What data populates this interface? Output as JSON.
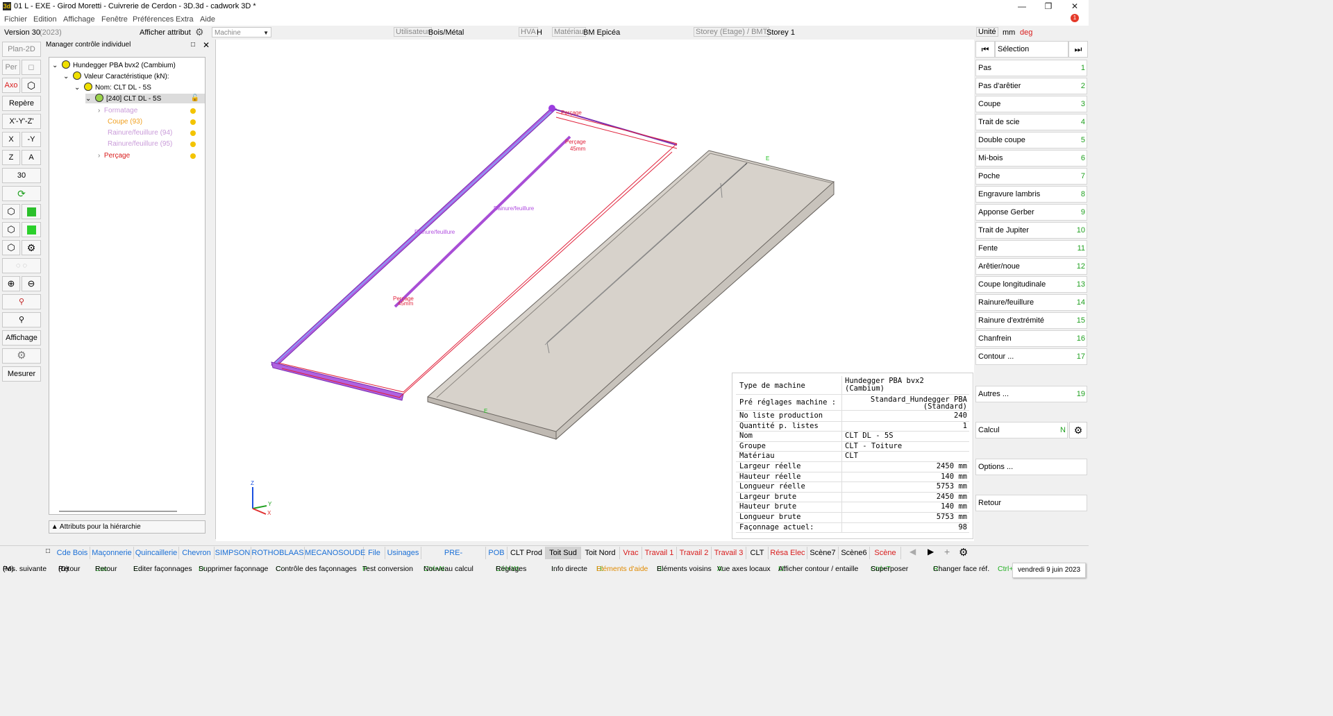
{
  "window": {
    "title": "01 L - EXE - Girod Moretti - Cuivrerie de Cerdon - 3D.3d - cadwork 3D *",
    "app_icon": "3d",
    "notification_count": "1"
  },
  "menu": [
    "Fichier",
    "Edition",
    "Affichage",
    "Fenêtre",
    "Préférences",
    "Extra",
    "Aide"
  ],
  "attrbar": {
    "version": "Version 30",
    "version_year": "(2023)",
    "afficher_attribut": "Afficher attribut",
    "machine_placeholder": "Machine",
    "utilisateur_label": "Utilisateur",
    "utilisateur_value": "Bois/Métal",
    "hva_label": "HVA",
    "hva_value": "H",
    "materiau_label": "Matériau",
    "materiau_value": "BM Epicéa",
    "storey_label": "Storey (Etage) / BMT",
    "storey_value": "Storey 1",
    "unite_label": "Unité",
    "unite_mm": "mm",
    "unite_deg": "deg"
  },
  "lefttb": {
    "plan2d": "Plan-2D",
    "per": "Per",
    "axo": "Axo",
    "repere": "Repère",
    "xyz": "X'-Y'-Z'",
    "x": "X",
    "mx": "-Y",
    "z": "Z",
    "a": "A",
    "thirty": "30",
    "affichage": "Affichage",
    "mesurer": "Mesurer"
  },
  "tree": {
    "panel_title": "Manager contrôle individuel",
    "items": [
      {
        "label": "Hundegger PBA bvx2 (Cambium)"
      },
      {
        "label": "Valeur Caractéristique (kN):"
      },
      {
        "label": "Nom: CLT DL - 5S"
      },
      {
        "label": "[240] CLT DL - 5S"
      },
      {
        "label": "Formatage"
      },
      {
        "label": "Coupe (93)"
      },
      {
        "label": "Rainure/feuillure (94)"
      },
      {
        "label": "Rainure/feuillure (95)"
      },
      {
        "label": "Perçage"
      }
    ],
    "hierarchy_button": "Attributs pour la hiérarchie"
  },
  "viewport": {
    "labels": {
      "percage1": "Perçage",
      "percage1_mm": "45mm",
      "percage2": "Perçage",
      "percage2_mm": "45mm",
      "rainure1": "Rainure/feuillure",
      "rainure2": "Rainure/feuillure",
      "percage_top": "Perçage",
      "axis_z": "Z",
      "axis_y": "Y",
      "axis_x": "X",
      "e1": "E",
      "e2": "E"
    }
  },
  "infotable": {
    "rows": [
      {
        "k": "Type de machine",
        "v": "Hundegger PBA bvx2",
        "v2": "(Cambium)"
      },
      {
        "k": "Pré réglages machine :",
        "v": "Standard_Hundegger PBA",
        "v2": "(Standard)"
      },
      {
        "k": "No liste production",
        "v": "240"
      },
      {
        "k": "Quantité p. listes",
        "v": "1"
      },
      {
        "k": "Nom",
        "v": "CLT DL - 5S"
      },
      {
        "k": "Groupe",
        "v": "CLT - Toiture"
      },
      {
        "k": "Matériau",
        "v": "CLT"
      },
      {
        "k": "Largeur réelle",
        "v": "2450  mm"
      },
      {
        "k": "Hauteur réelle",
        "v": "140  mm"
      },
      {
        "k": "Longueur réelle",
        "v": "5753  mm"
      },
      {
        "k": "Largeur brute",
        "v": "2450  mm"
      },
      {
        "k": "Hauteur brute",
        "v": "140  mm"
      },
      {
        "k": "Longueur brute",
        "v": "5753  mm"
      },
      {
        "k": "Façonnage actuel:",
        "v": "98"
      }
    ]
  },
  "rightpanel": {
    "selection": "Sélection",
    "items": [
      {
        "label": "Pas",
        "n": "1"
      },
      {
        "label": "Pas d'arêtier",
        "n": "2"
      },
      {
        "label": "Coupe",
        "n": "3"
      },
      {
        "label": "Trait de scie",
        "n": "4"
      },
      {
        "label": "Double coupe",
        "n": "5"
      },
      {
        "label": "Mi-bois",
        "n": "6"
      },
      {
        "label": "Poche",
        "n": "7"
      },
      {
        "label": "Engravure lambris",
        "n": "8"
      },
      {
        "label": "Apponse Gerber",
        "n": "9"
      },
      {
        "label": "Trait de Jupiter",
        "n": "10"
      },
      {
        "label": "Fente",
        "n": "11"
      },
      {
        "label": "Arêtier/noue",
        "n": "12"
      },
      {
        "label": "Coupe longitudinale",
        "n": "13"
      },
      {
        "label": "Rainure/feuillure",
        "n": "14"
      },
      {
        "label": "Rainure d'extrémité",
        "n": "15"
      },
      {
        "label": "Chanfrein",
        "n": "16"
      },
      {
        "label": "Contour ...",
        "n": "17"
      }
    ],
    "autres": "Autres ...",
    "autres_n": "19",
    "calcul": "Calcul",
    "calcul_n": "N",
    "options": "Options ...",
    "retour": "Retour"
  },
  "tabs": [
    {
      "label": "Cde Bois",
      "color": "#1a6fd6"
    },
    {
      "label": "Maçonnerie",
      "color": "#1a6fd6"
    },
    {
      "label": "Quincaillerie",
      "color": "#1a6fd6"
    },
    {
      "label": "Chevron",
      "color": "#1a6fd6"
    },
    {
      "label": "SIMPSON",
      "color": "#1a6fd6"
    },
    {
      "label": "ROTHOBLAAS",
      "color": "#1a6fd6"
    },
    {
      "label": "MECANOSOUDE",
      "color": "#1a6fd6"
    },
    {
      "label": "File",
      "color": "#1a6fd6"
    },
    {
      "label": "Usinages",
      "color": "#1a6fd6"
    },
    {
      "label": "PRE-SCELLEMENT",
      "color": "#1a6fd6"
    },
    {
      "label": "POB",
      "color": "#1a6fd6"
    },
    {
      "label": "CLT Prod",
      "color": "#000000"
    },
    {
      "label": "Toit Sud",
      "color": "#000000"
    },
    {
      "label": "Toit Nord",
      "color": "#000000"
    },
    {
      "label": "Vrac",
      "color": "#d81b1b"
    },
    {
      "label": "Travail 1",
      "color": "#d81b1b"
    },
    {
      "label": "Travail 2",
      "color": "#d81b1b"
    },
    {
      "label": "Travail 3",
      "color": "#d81b1b"
    },
    {
      "label": "CLT",
      "color": "#000000"
    },
    {
      "label": "Résa Elec",
      "color": "#d81b1b"
    },
    {
      "label": "Scène7",
      "color": "#000000"
    },
    {
      "label": "Scène6",
      "color": "#000000"
    },
    {
      "label": "Scène",
      "color": "#d81b1b"
    }
  ],
  "status": [
    {
      "key": "(M)",
      "text": "Pos. suivante"
    },
    {
      "key": "(D)",
      "text": "Retour"
    },
    {
      "key": "Esc:",
      "text": "Retour"
    },
    {
      "key": "E:",
      "text": "Editer façonnages"
    },
    {
      "key": "D:",
      "text": "Supprimer façonnage"
    },
    {
      "key": "C:",
      "text": "Contrôle des façonnages"
    },
    {
      "key": "P:",
      "text": "Test conversion"
    },
    {
      "key": "Ctrl+N:",
      "text": "Nouveau calcul"
    },
    {
      "key": "Ctrl+W:",
      "text": "Réglages"
    },
    {
      "key": "I:",
      "text": "Info directe"
    },
    {
      "key": "H:",
      "text": "Eléments d'aide"
    },
    {
      "key": "B:",
      "text": "Eléments voisins"
    },
    {
      "key": "A:",
      "text": "Vue axes locaux"
    },
    {
      "key": "U:",
      "text": "Afficher contour / entaille"
    },
    {
      "key": "Ctrl+T:",
      "text": "Superposer"
    },
    {
      "key": "R:",
      "text": "Changer face réf."
    },
    {
      "key": "Ctrl+",
      "text": ""
    }
  ],
  "date": "vendredi 9 juin 2023"
}
